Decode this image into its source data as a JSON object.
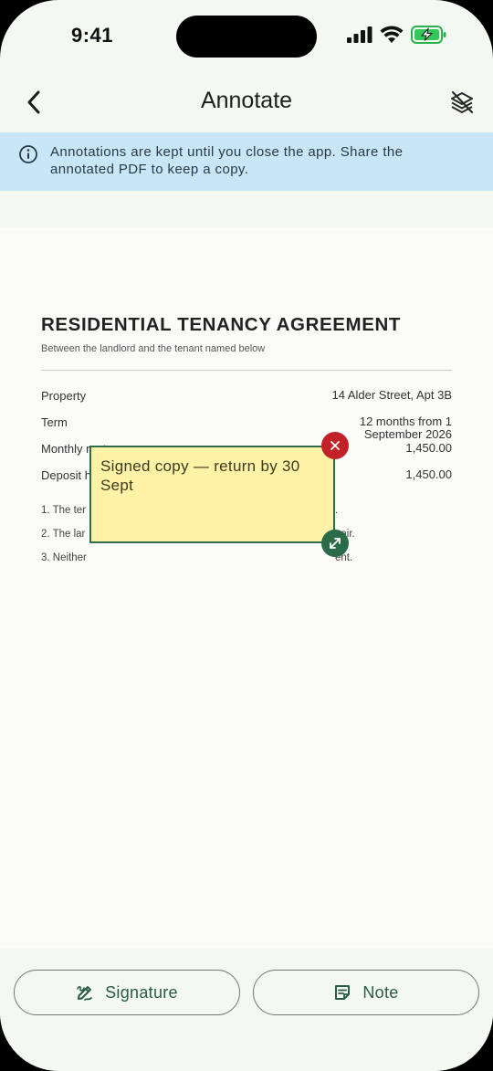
{
  "status_bar": {
    "time": "9:41"
  },
  "app_bar": {
    "title": "Annotate",
    "back_icon": "chevron-left-icon",
    "layers_icon": "layers-off-icon"
  },
  "banner": {
    "icon": "info-icon",
    "text": "Annotations are kept until you close the app. Share the annotated PDF to keep a copy.",
    "background": "#c8e6f7"
  },
  "document": {
    "title": "RESIDENTIAL TENANCY AGREEMENT",
    "subtitle": "Between the landlord and the tenant named below",
    "rows": [
      {
        "label": "Property",
        "value": "14 Alder Street, Apt 3B"
      },
      {
        "label": "Term",
        "value": "12 months from 1 September 2026"
      },
      {
        "label": "Monthly rent",
        "value": "1,450.00"
      },
      {
        "label": "Deposit held",
        "value": "1,450.00"
      }
    ],
    "clauses": [
      {
        "left": "1. The ter",
        "right": "."
      },
      {
        "left": "2. The lar",
        "right": "pair."
      },
      {
        "left": "3. Neither",
        "right": "ent."
      }
    ]
  },
  "note": {
    "text": "Signed copy — return by 30 Sept",
    "background": "#fdf2a6",
    "border": "#2f6b4a",
    "close_icon": "close-icon",
    "close_color": "#c02227",
    "resize_icon": "resize-icon",
    "resize_color": "#2a6b4a"
  },
  "actions": {
    "signature_label": "Signature",
    "signature_icon": "signature-icon",
    "note_label": "Note",
    "note_icon": "note-icon",
    "accent": "#2a5b45"
  }
}
